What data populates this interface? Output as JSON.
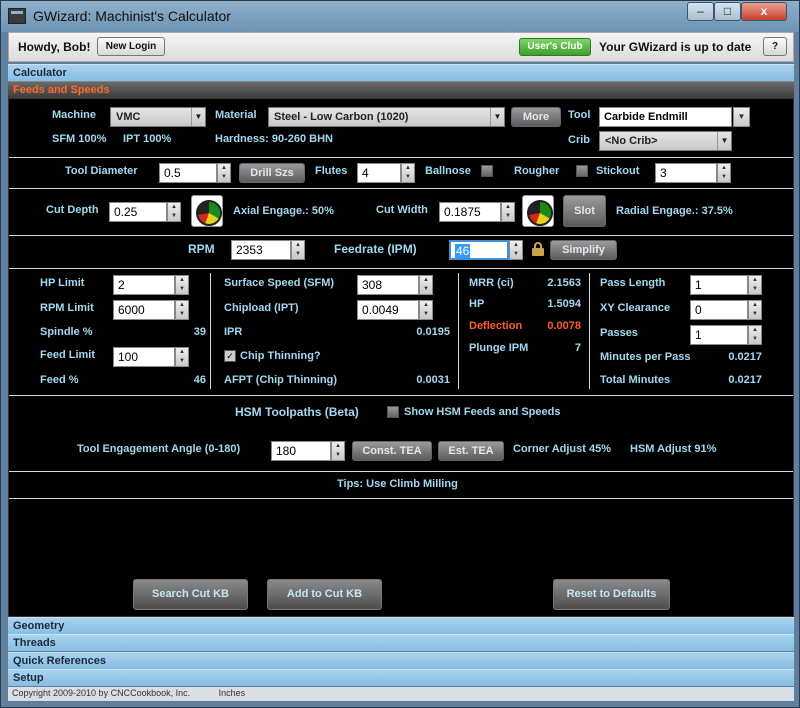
{
  "window": {
    "title": "GWizard: Machinist's Calculator",
    "minimize": "–",
    "maximize": "□",
    "close": "x"
  },
  "topbar": {
    "greeting": "Howdy, Bob!",
    "new_login": "New Login",
    "users_club": "User's Club",
    "status": "Your GWizard is up to date",
    "help": "?"
  },
  "accordion": {
    "calculator": "Calculator",
    "feeds": "Feeds and Speeds",
    "geometry": "Geometry",
    "threads": "Threads",
    "quick_refs": "Quick References",
    "setup": "Setup"
  },
  "machine": {
    "label": "Machine",
    "value": "VMC",
    "material_label": "Material",
    "material": "Steel - Low Carbon (1020)",
    "more": "More",
    "tool_label": "Tool",
    "tool": "Carbide Endmill",
    "sfm": "SFM 100%",
    "ipt": "IPT 100%",
    "hardness": "Hardness: 90-260 BHN",
    "crib_label": "Crib",
    "crib": "<No Crib>"
  },
  "tool": {
    "diameter_label": "Tool Diameter",
    "diameter": "0.5",
    "drill_sizes": "Drill Szs",
    "flutes_label": "Flutes",
    "flutes": "4",
    "ballnose": "Ballnose",
    "rougher": "Rougher",
    "stickout_label": "Stickout",
    "stickout": "3"
  },
  "cut": {
    "depth_label": "Cut Depth",
    "depth": "0.25",
    "gauge_text": "Cut",
    "axial": "Axial Engage.: 50%",
    "width_label": "Cut Width",
    "width": "0.1875",
    "slot": "Slot",
    "radial": "Radial Engage.: 37.5%"
  },
  "rpm": {
    "label": "RPM",
    "value": "2353",
    "feed_label": "Feedrate (IPM)",
    "feed": "46",
    "simplify": "Simplify"
  },
  "limits": {
    "hp_label": "HP Limit",
    "hp": "2",
    "rpm_label": "RPM Limit",
    "rpm": "6000",
    "spindle_label": "Spindle %",
    "spindle": "39",
    "feed_label": "Feed Limit",
    "feed": "100",
    "feedpct_label": "Feed %",
    "feedpct": "46"
  },
  "surface": {
    "sfm_label": "Surface Speed (SFM)",
    "sfm": "308",
    "chip_label": "Chipload (IPT)",
    "chip": "0.0049",
    "ipr_label": "IPR",
    "ipr": "0.0195",
    "thinning_label": "Chip Thinning?",
    "afpt_label": "AFPT (Chip Thinning)",
    "afpt": "0.0031"
  },
  "mrr": {
    "mrr_label": "MRR (ci)",
    "mrr": "2.1563",
    "hp_label": "HP",
    "hp": "1.5094",
    "defl_label": "Deflection",
    "defl": "0.0078",
    "plunge_label": "Plunge IPM",
    "plunge": "7"
  },
  "pass": {
    "length_label": "Pass Length",
    "length": "1",
    "xy_label": "XY Clearance",
    "xy": "0",
    "passes_label": "Passes",
    "passes": "1",
    "mpp_label": "Minutes per Pass",
    "mpp": "0.0217",
    "total_label": "Total Minutes",
    "total": "0.0217"
  },
  "hsm": {
    "title": "HSM Toolpaths (Beta)",
    "show_label": "Show HSM Feeds and Speeds",
    "angle_label": "Tool Engagement Angle (0-180)",
    "angle": "180",
    "const_tea": "Const. TEA",
    "est_tea": "Est. TEA",
    "corner": "Corner Adjust 45%",
    "hsm_adjust": "HSM Adjust 91%"
  },
  "tips": {
    "text": "Tips:  Use Climb Milling"
  },
  "actions": {
    "search": "Search Cut KB",
    "add": "Add to Cut KB",
    "reset": "Reset to Defaults"
  },
  "footer": {
    "copyright": "Copyright 2009-2010 by CNCCookbook, Inc.",
    "units": "Inches"
  }
}
